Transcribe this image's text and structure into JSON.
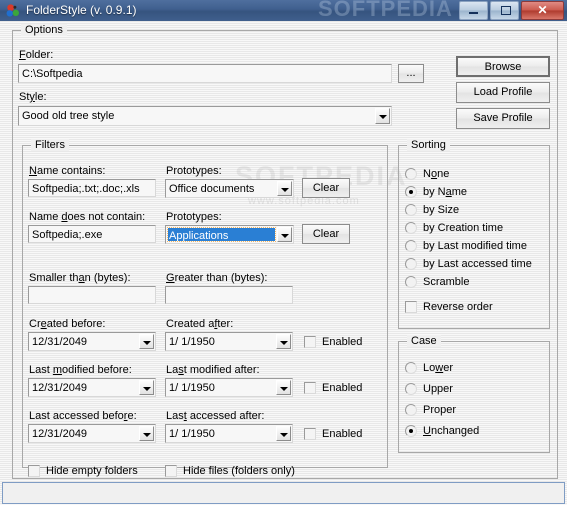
{
  "window": {
    "title": "FolderStyle (v. 0.9.1)",
    "icon": "app-spheres-icon",
    "watermark_title": "SOFTPEDIA",
    "watermark_body": "SOFTPEDIA",
    "watermark_body_url": "www.softpedia.com",
    "controls": {
      "minimize": "–",
      "maximize": "□",
      "close": "✕"
    },
    "colors": {
      "titlebar": "#40608f",
      "client_bg": "#f0f0f0",
      "selection_blue": "#2a7fd4",
      "close_red": "#cb5a4e"
    }
  },
  "options": {
    "legend": "Options",
    "folder_label": "Folder:",
    "folder_value": "C:\\Softpedia",
    "browse_dots_label": "...",
    "style_label": "Style:",
    "style_value": "Good old tree style",
    "buttons": {
      "browse": "Browse",
      "load_profile": "Load Profile",
      "save_profile": "Save Profile"
    }
  },
  "filters": {
    "legend": "Filters",
    "name_contains_label": "Name contains:",
    "name_contains_value": "Softpedia;.txt;.doc;.xls",
    "prototypes_label_1": "Prototypes:",
    "prototypes_value_1": "Office documents",
    "clear_label_1": "Clear",
    "name_not_contains_label": "Name does not contain:",
    "name_not_contains_value": "Softpedia;.exe",
    "prototypes_label_2": "Prototypes:",
    "prototypes_value_2": "Applications",
    "clear_label_2": "Clear",
    "smaller_than_label": "Smaller than (bytes):",
    "smaller_than_value": "",
    "greater_than_label": "Greater than (bytes):",
    "greater_than_value": "",
    "created_before_label": "Created before:",
    "created_before_value": "12/31/2049",
    "created_after_label": "Created after:",
    "created_after_value": "1/  1/1950",
    "created_enabled_label": "Enabled",
    "modified_before_label": "Last modified before:",
    "modified_before_value": "12/31/2049",
    "modified_after_label": "Last modified after:",
    "modified_after_value": "1/  1/1950",
    "modified_enabled_label": "Enabled",
    "accessed_before_label": "Last accessed before:",
    "accessed_before_value": "12/31/2049",
    "accessed_after_label": "Last accessed after:",
    "accessed_after_value": "1/  1/1950",
    "accessed_enabled_label": "Enabled",
    "hide_empty_folders_label": "Hide empty folders",
    "hide_files_label": "Hide files (folders only)"
  },
  "sorting": {
    "legend": "Sorting",
    "options": [
      "None",
      "by Name",
      "by Size",
      "by Creation time",
      "by Last modified time",
      "by Last accessed time",
      "Scramble"
    ],
    "selected": "by Name",
    "reverse_order_label": "Reverse order",
    "reverse_order_checked": false
  },
  "case": {
    "legend": "Case",
    "options": [
      "Lower",
      "Upper",
      "Proper",
      "Unchanged"
    ],
    "selected": "Unchanged"
  }
}
